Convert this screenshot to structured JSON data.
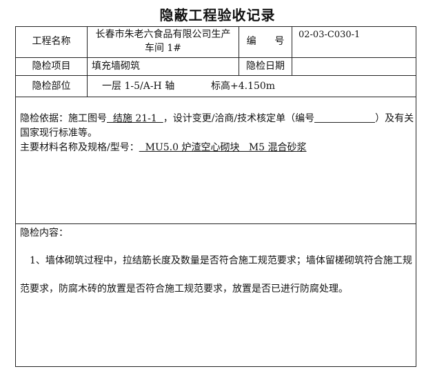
{
  "document": {
    "title": "隐蔽工程验收记录"
  },
  "info_rows": {
    "project_name_label": "工程名称",
    "project_name_value_line1": "长春市朱老六食品有限公司生产",
    "project_name_value_line2": "车间  1#",
    "number_label": "编      号",
    "number_value": "02-03-C030-1",
    "inspection_item_label": "隐检项目",
    "inspection_item_value": "填充墙砌筑",
    "inspection_date_label": "隐检日期",
    "inspection_date_value": "",
    "inspection_location_label": "隐检部位",
    "inspection_location_value": "一层 1-5/A-H 轴",
    "elevation_text": "标高+4.150m"
  },
  "basis_section": {
    "basis_prefix": "隐检依据：施工图号",
    "drawing_number": "  结施 21-1  ",
    "basis_middle": "，设计变更/洽商/技术核定单（编号",
    "basis_suffix": "）及有关",
    "basis_line2": "国家现行标准等。",
    "materials_prefix": "主要材料名称及规格/型号：",
    "materials_value": "  MU5.0 炉渣空心砌块   M5 混合砂浆"
  },
  "content_section": {
    "label": "隐检内容：",
    "item1_line1": "1、墙体砌筑过程中，拉结筋长度及数量是否符合施工规范要求；墙体留槎砌筑符合施工规",
    "item1_line2": "范要求，防腐木砖的放置是否符合施工规范要求，放置是否已进行防腐处理。"
  }
}
